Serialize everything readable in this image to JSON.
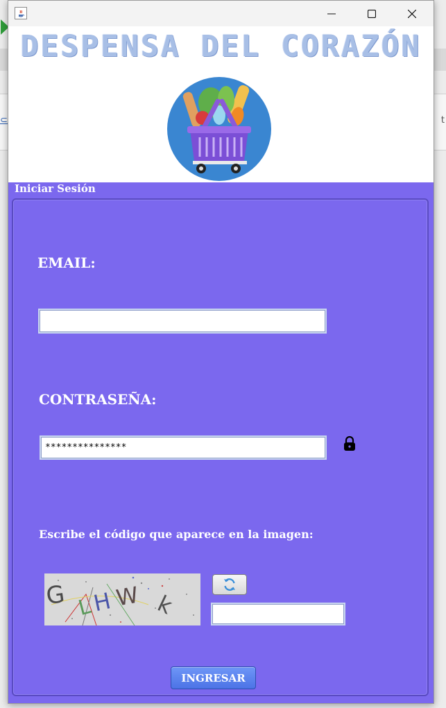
{
  "window": {
    "title": "",
    "minimize_icon": "minimize-icon",
    "maximize_icon": "maximize-icon",
    "close_icon": "close-icon"
  },
  "banner": {
    "title": "DESPENSA DEL CORAZÓN",
    "logo": "grocery-basket-logo"
  },
  "login": {
    "section_label": "Iniciar Sesión",
    "email_label": "EMAIL:",
    "email_value": "",
    "password_label": "CONTRASEÑA:",
    "password_value": "***************",
    "password_icon": "lock-icon",
    "captcha_label": "Escribe el código que aparece en la imagen:",
    "captcha_refresh_icon": "refresh-icon",
    "captcha_value": "",
    "submit_label": "INGRESAR"
  },
  "colors": {
    "panel_bg": "#7b68ee",
    "submit_bg": "#5b82f0",
    "banner_title": "#a8bfe6"
  }
}
